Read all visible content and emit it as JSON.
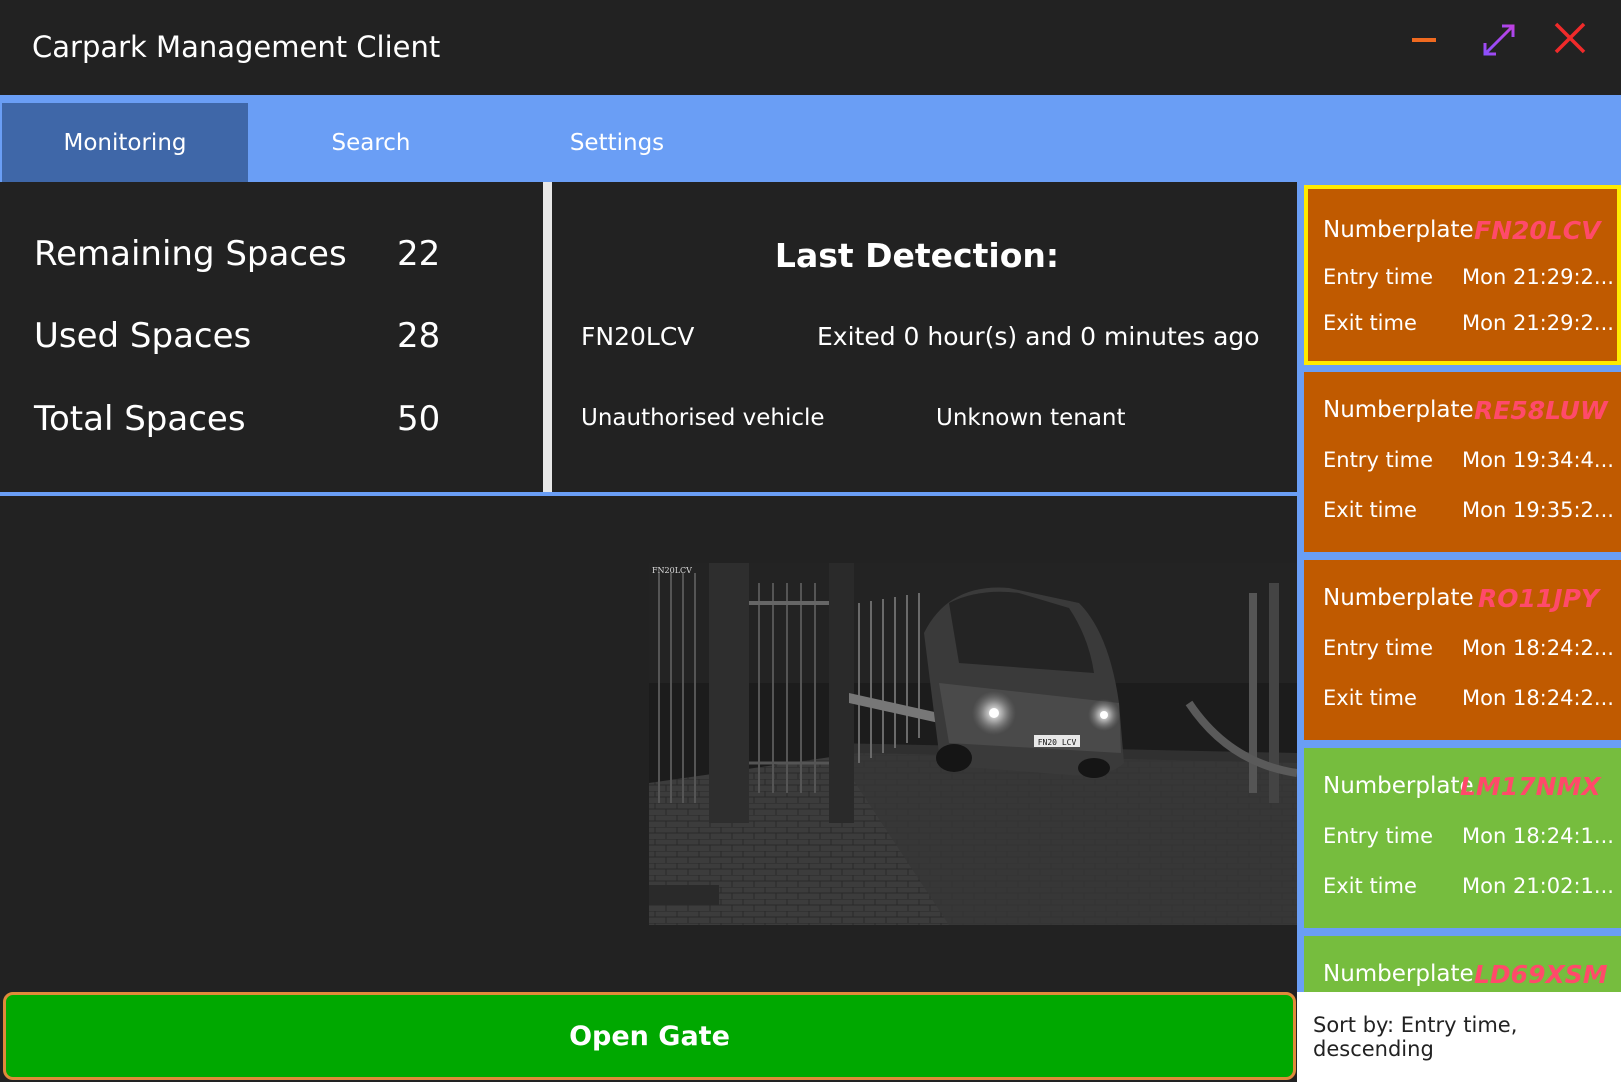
{
  "window": {
    "title": "Carpark Management Client"
  },
  "tabs": [
    {
      "label": "Monitoring",
      "active": true
    },
    {
      "label": "Search",
      "active": false
    },
    {
      "label": "Settings",
      "active": false
    }
  ],
  "stats": {
    "remaining_label": "Remaining Spaces",
    "remaining_value": "22",
    "used_label": "Used Spaces",
    "used_value": "28",
    "total_label": "Total Spaces",
    "total_value": "50"
  },
  "detection": {
    "title": "Last Detection:",
    "plate": "FN20LCV",
    "exit_status": "Exited 0 hour(s) and 0 minutes ago",
    "authorisation": "Unauthorised vehicle",
    "tenant": "Unknown tenant",
    "camera_plate_text": "FN20 LCV",
    "camera_caption": "FN20LCV"
  },
  "vehicle_list": {
    "numberplate_label": "Numberplate",
    "entry_label": "Entry time",
    "exit_label": "Exit time",
    "items": [
      {
        "plate": "FN20LCV",
        "entry": "Mon 21:29:2...",
        "exit": "Mon 21:29:2...",
        "color": "orange",
        "selected": true
      },
      {
        "plate": "RE58LUW",
        "entry": "Mon 19:34:4...",
        "exit": "Mon 19:35:2...",
        "color": "orange",
        "selected": false
      },
      {
        "plate": "RO11JPY",
        "entry": "Mon 18:24:2...",
        "exit": "Mon 18:24:2...",
        "color": "orange",
        "selected": false
      },
      {
        "plate": "LM17NMX",
        "entry": "Mon 18:24:1...",
        "exit": "Mon 21:02:1...",
        "color": "green",
        "selected": false
      },
      {
        "plate": "LD69XSM",
        "entry": "",
        "exit": "",
        "color": "green",
        "selected": false
      }
    ]
  },
  "actions": {
    "open_gate_label": "Open Gate"
  },
  "sort": {
    "label": "Sort by: Entry time, descending"
  },
  "colors": {
    "accent_blue": "#6a9ef5",
    "tab_active": "#3f67a8",
    "card_orange": "#c05a00",
    "card_green": "#76bd3e",
    "plate_red": "#ff4a6a",
    "selected_border": "#ffeb00",
    "gate_green": "#00a800"
  }
}
